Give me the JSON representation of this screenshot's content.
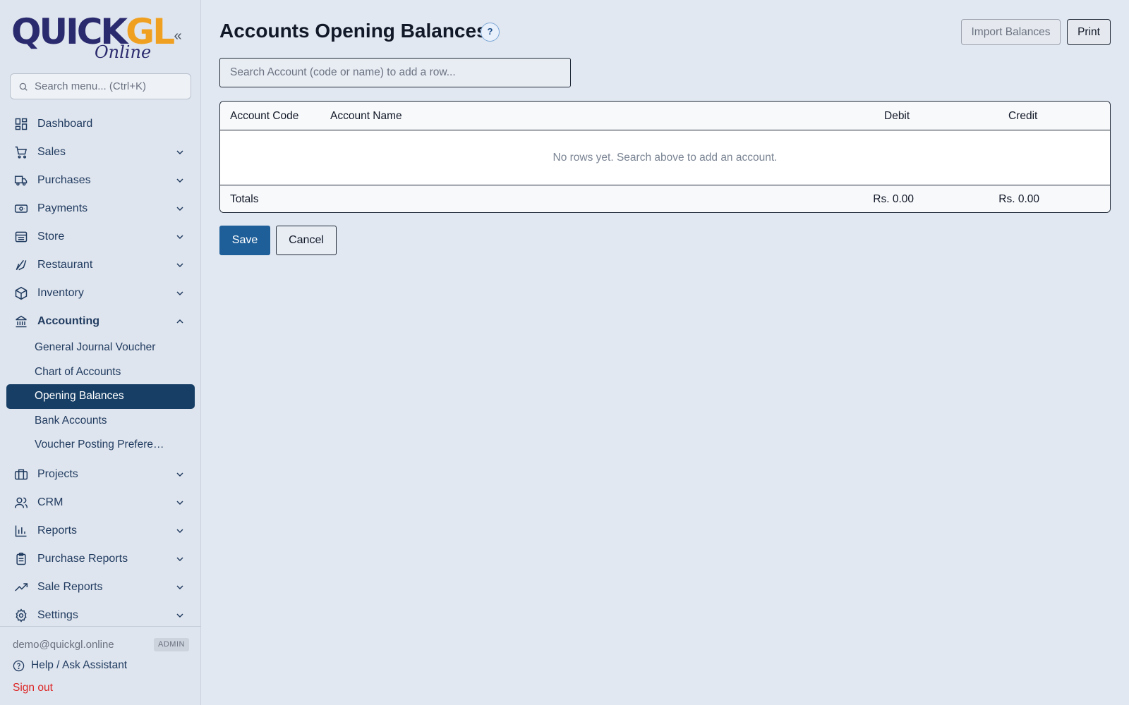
{
  "brand": {
    "logo_main": "QUICK",
    "logo_accent": "GL",
    "logo_sub": "Online"
  },
  "sidebar": {
    "search_placeholder": "Search menu... (Ctrl+K)",
    "items": [
      {
        "label": "Dashboard",
        "icon": "dashboard-icon"
      },
      {
        "label": "Sales",
        "icon": "cart-icon"
      },
      {
        "label": "Purchases",
        "icon": "truck-icon"
      },
      {
        "label": "Payments",
        "icon": "banknote-icon"
      },
      {
        "label": "Store",
        "icon": "store-icon"
      },
      {
        "label": "Restaurant",
        "icon": "utensils-icon"
      },
      {
        "label": "Inventory",
        "icon": "package-icon"
      },
      {
        "label": "Accounting",
        "icon": "bank-icon"
      },
      {
        "label": "Projects",
        "icon": "briefcase-icon"
      },
      {
        "label": "CRM",
        "icon": "users-icon"
      },
      {
        "label": "Reports",
        "icon": "bar-chart-icon"
      },
      {
        "label": "Purchase Reports",
        "icon": "clipboard-icon"
      },
      {
        "label": "Sale Reports",
        "icon": "trending-up-icon"
      },
      {
        "label": "Settings",
        "icon": "gear-icon"
      }
    ],
    "accounting_sub": [
      "General Journal Voucher",
      "Chart of Accounts",
      "Opening Balances",
      "Bank Accounts",
      "Voucher Posting Prefere…"
    ],
    "active_sub": "Opening Balances",
    "user_email": "demo@quickgl.online",
    "role": "ADMIN",
    "help_label": "Help / Ask Assistant",
    "signout_label": "Sign out"
  },
  "main": {
    "title": "Accounts Opening Balances",
    "help_glyph": "?",
    "import_label": "Import Balances",
    "print_label": "Print",
    "search_placeholder": "Search Account (code or name) to add a row...",
    "table": {
      "columns": [
        "Account Code",
        "Account Name",
        "Debit",
        "Credit"
      ],
      "empty_message": "No rows yet. Search above to add an account.",
      "totals_label": "Totals",
      "total_debit": "Rs. 0.00",
      "total_credit": "Rs. 0.00"
    },
    "save_label": "Save",
    "cancel_label": "Cancel"
  },
  "colors": {
    "accent": "#1f5f99",
    "active_nav": "#173f66",
    "signout": "#dc2626",
    "logo_accent": "#f0a020"
  }
}
